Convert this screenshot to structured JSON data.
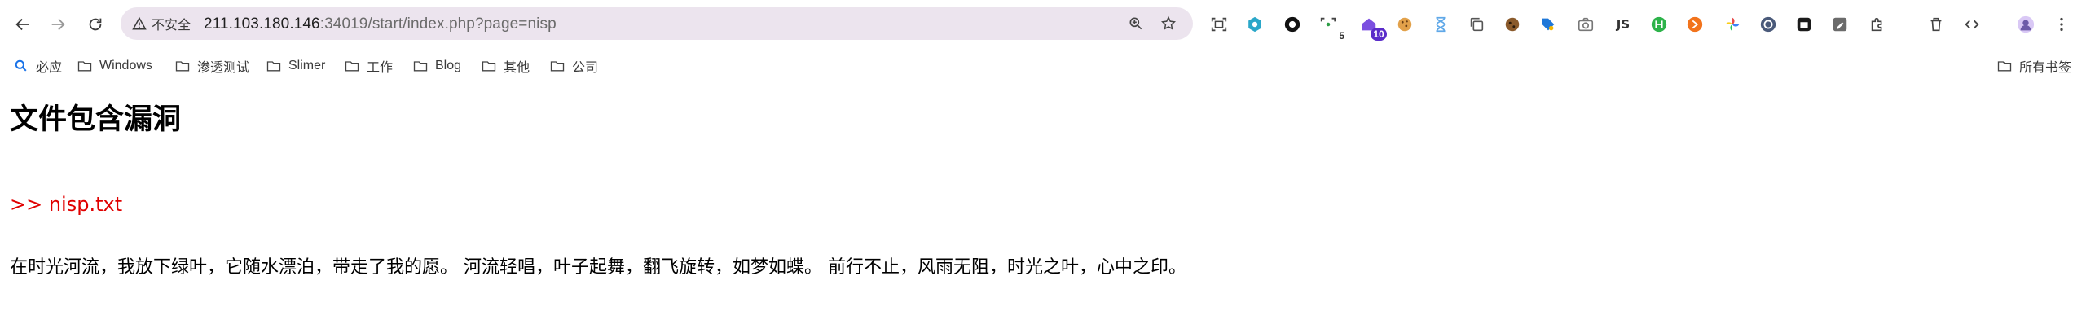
{
  "browser": {
    "address_bar": {
      "security_label": "不安全",
      "url_host": "211.103.180.146",
      "url_rest": ":34019/start/index.php?page=nisp"
    },
    "extensions": {
      "purple_badge": "10",
      "green_badge": "5",
      "js_label": "JS"
    },
    "bookmarks": [
      {
        "label": "必应",
        "icon": "search-icon"
      },
      {
        "label": "Windows",
        "icon": "folder-icon"
      },
      {
        "label": "渗透测试",
        "icon": "folder-icon"
      },
      {
        "label": "Slimer",
        "icon": "folder-icon"
      },
      {
        "label": "工作",
        "icon": "folder-icon"
      },
      {
        "label": "Blog",
        "icon": "folder-icon"
      },
      {
        "label": "其他",
        "icon": "folder-icon"
      },
      {
        "label": "公司",
        "icon": "folder-icon"
      }
    ],
    "all_bookmarks_label": "所有书签"
  },
  "page": {
    "title": "文件包含漏洞",
    "file_label": ">> nisp.txt",
    "file_content": "在时光河流，我放下绿叶，它随水漂泊，带走了我的愿。 河流轻唱，叶子起舞，翻飞旋转，如梦如蝶。 前行不止，风雨无阻，时光之叶，心中之印。"
  },
  "colors": {
    "file_label": "#e00000",
    "omnibox_bg": "#ece4ee",
    "badge": "#5a2cc9"
  }
}
